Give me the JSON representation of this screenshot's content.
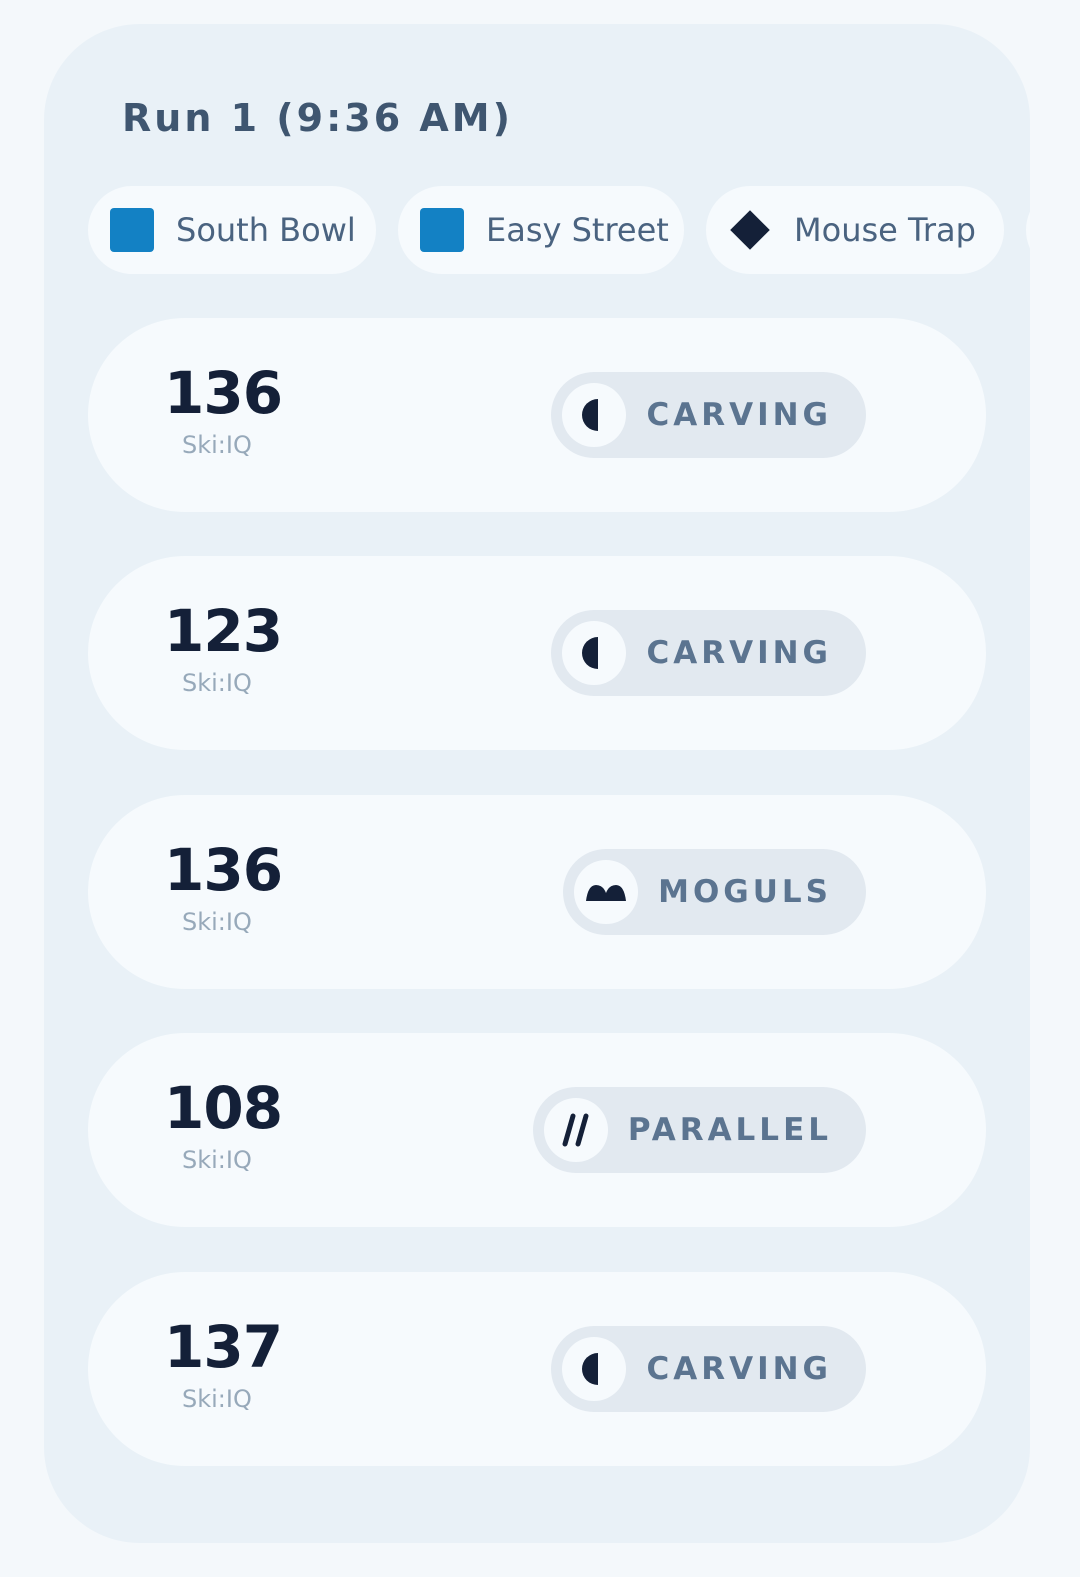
{
  "run": {
    "title": "Run 1 (9:36 AM)"
  },
  "trails": [
    {
      "name": "South Bowl",
      "difficulty_icon": "blue-square-icon",
      "color": "#1381c4"
    },
    {
      "name": "Easy Street",
      "difficulty_icon": "blue-square-icon",
      "color": "#1381c4"
    },
    {
      "name": "Mouse Trap",
      "difficulty_icon": "black-diamond-icon",
      "color": "#142038"
    }
  ],
  "turns": [
    {
      "score": "136",
      "unit": "Ski:IQ",
      "type": "CARVING",
      "icon": "carving-icon"
    },
    {
      "score": "123",
      "unit": "Ski:IQ",
      "type": "CARVING",
      "icon": "carving-icon"
    },
    {
      "score": "136",
      "unit": "Ski:IQ",
      "type": "MOGULS",
      "icon": "moguls-icon"
    },
    {
      "score": "108",
      "unit": "Ski:IQ",
      "type": "PARALLEL",
      "icon": "parallel-icon"
    },
    {
      "score": "137",
      "unit": "Ski:IQ",
      "type": "CARVING",
      "icon": "carving-icon"
    }
  ],
  "colors": {
    "page_bg": "#f4f8fb",
    "card_bg": "#e9f1f7",
    "score_text": "#142038",
    "tag_bg": "#e2e9f0",
    "tag_text": "#5b7490"
  }
}
